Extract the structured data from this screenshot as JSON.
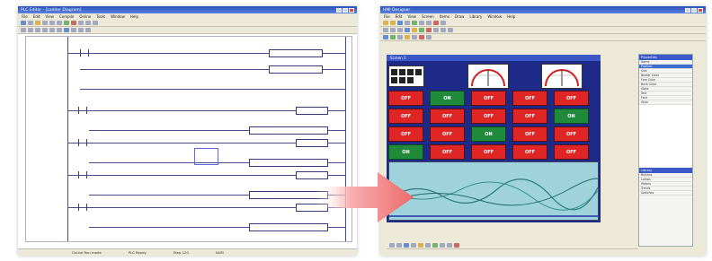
{
  "left_app": {
    "title": "PLC Editor - [Ladder Diagram]",
    "menu": [
      "File",
      "Edit",
      "View",
      "Compile",
      "Online",
      "Tools",
      "Window",
      "Help"
    ],
    "status": [
      "Online  Run mode",
      "PLC Ready",
      "Step 120",
      "NUM"
    ]
  },
  "right_app": {
    "title": "HMI Designer",
    "menu": [
      "File",
      "Edit",
      "View",
      "Screen",
      "Items",
      "Draw",
      "Library",
      "Window",
      "Help"
    ],
    "screen_title": "Screen 1",
    "buttons": [
      [
        "OFF",
        "ON",
        "OFF",
        "OFF",
        "OFF"
      ],
      [
        "OFF",
        "OFF",
        "OFF",
        "OFF",
        "ON"
      ],
      [
        "OFF",
        "OFF",
        "ON",
        "OFF",
        "OFF"
      ],
      [
        "ON",
        "OFF",
        "OFF",
        "OFF",
        "OFF"
      ]
    ],
    "properties_title": "Properties",
    "properties": [
      "Name",
      "Position",
      "Size",
      "Border Color",
      "Fore Color",
      "Back Color",
      "State",
      "Text",
      "Font",
      "Style"
    ],
    "library_title": "Library",
    "library": [
      "Buttons",
      "Lamps",
      "Meters",
      "Trends",
      "Switches"
    ]
  },
  "colors": {
    "off": "#e02525",
    "on": "#1f8a3a",
    "panel": "#1d2a88",
    "arrow": "#f0787a"
  }
}
